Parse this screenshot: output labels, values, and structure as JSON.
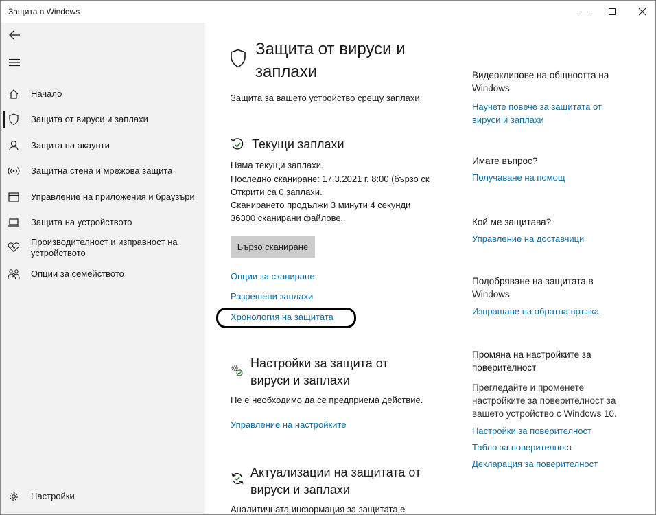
{
  "window": {
    "title": "Защита в Windows",
    "controls": [
      "minimize-icon",
      "maximize-icon",
      "close-icon"
    ]
  },
  "sidebar": {
    "back_icon": "back-arrow-icon",
    "menu_icon": "hamburger-menu-icon",
    "items": [
      {
        "label": "Начало",
        "icon": "home-icon",
        "active": false
      },
      {
        "label": "Защита от вируси и заплахи",
        "icon": "shield-icon",
        "active": true
      },
      {
        "label": "Защита на акаунти",
        "icon": "person-icon",
        "active": false
      },
      {
        "label": "Защитна стена и мрежова защита",
        "icon": "wireless-icon",
        "active": false
      },
      {
        "label": "Управление на приложения и браузъри",
        "icon": "browser-window-icon",
        "active": false
      },
      {
        "label": "Защита на устройството",
        "icon": "laptop-icon",
        "active": false
      },
      {
        "label": "Производителност и изправност на устройството",
        "label_line1": "Производителност и изправност на",
        "label_line2": "устройството",
        "icon": "heart-pulse-icon",
        "active": false
      },
      {
        "label": "Опции за семейството",
        "icon": "family-icon",
        "active": false
      }
    ],
    "settings": {
      "label": "Настройки",
      "icon": "gear-icon"
    }
  },
  "main": {
    "title_line1": "Защита от вируси и",
    "title_line2": "заплахи",
    "subtitle": "Защита за вашето устройство срещу заплахи.",
    "current_threats": {
      "title": "Текущи заплахи",
      "lines": [
        "Няма текущи заплахи.",
        "Последно сканиране: 17.3.2021 г. 8:00 (бързо ск",
        "Открити са 0 заплахи.",
        "Сканирането продължи 3 минути 4 секунди",
        "36300 сканирани файлове."
      ],
      "quick_scan_button": "Бързо сканиране",
      "links": [
        "Опции за сканиране",
        "Разрешени заплахи",
        "Хронология на защитата"
      ]
    },
    "settings_section": {
      "title_line1": "Настройки за защита от",
      "title_line2": "вируси и заплахи",
      "text": "Не е необходимо да се предприема действие.",
      "link": "Управление на настройките"
    },
    "updates_section": {
      "title_line1": "Актуализации на защитата от",
      "title_line2": "вируси и заплахи",
      "text": "Аналитичната информация за защитата е"
    }
  },
  "right_column": {
    "community": {
      "head_line1": "Видеоклипове на общността на",
      "head_line2": "Windows",
      "link_line1": "Научете повече за защитата от",
      "link_line2": "вируси и заплахи"
    },
    "question": {
      "head": "Имате въпрос?",
      "link": "Получаване на помощ"
    },
    "protector": {
      "head": "Кой ме защитава?",
      "link": "Управление на доставчици"
    },
    "improve": {
      "head_line1": "Подобряване на защитата в",
      "head_line2": "Windows",
      "link": "Изпращане на обратна връзка"
    },
    "privacy": {
      "head_line1": "Промяна на настройките за",
      "head_line2": "поверителност",
      "text_line1": "Прегледайте и променете",
      "text_line2": "настройките за поверителност за",
      "text_line3": "вашето устройство с Windows 10.",
      "links": [
        "Настройки за поверителност",
        "Табло за поверителност",
        "Декларация за поверителност"
      ]
    }
  },
  "colors": {
    "link": "#0a6ea8",
    "sidebar_bg": "#f2f2f2",
    "button_bg": "#cccccc",
    "highlight": "#000000"
  }
}
